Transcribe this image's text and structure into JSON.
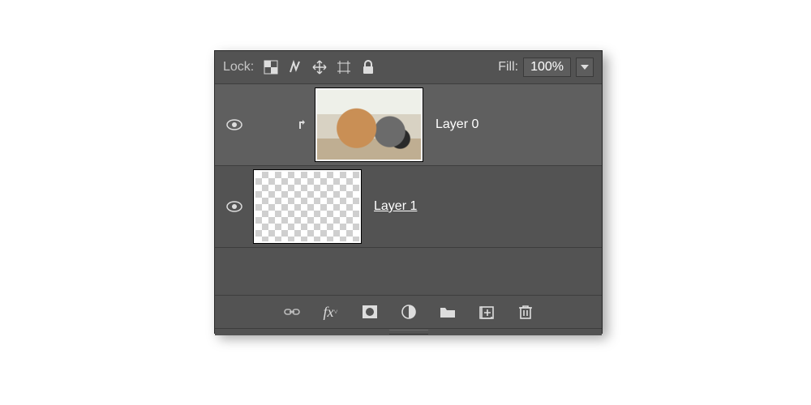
{
  "lockbar": {
    "label": "Lock:",
    "fill_label": "Fill:",
    "fill_value": "100%"
  },
  "layers": [
    {
      "name": "Layer 0",
      "clipped": true,
      "selected": true,
      "thumb": "photo"
    },
    {
      "name": "Layer 1",
      "clipped": false,
      "selected": false,
      "thumb": "transparent",
      "underline": true
    }
  ]
}
